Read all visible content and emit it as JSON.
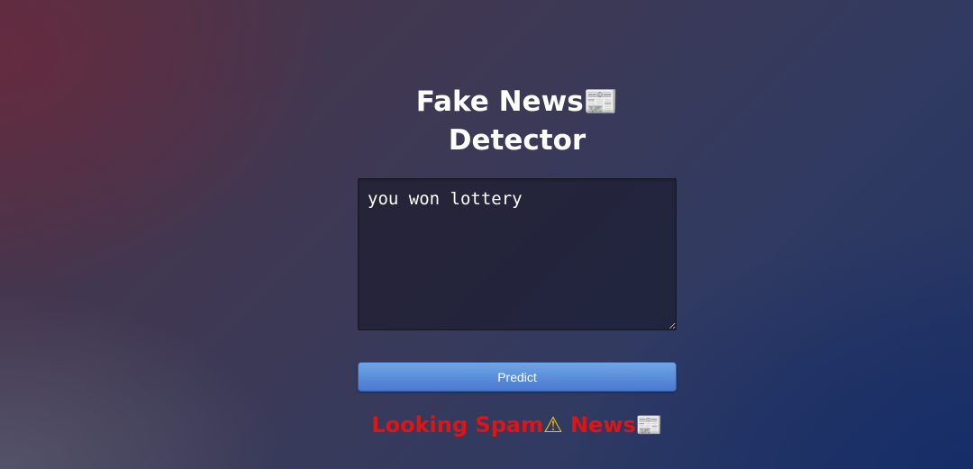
{
  "header": {
    "title_line1": "Fake News",
    "title_line2": "Detector",
    "title_icon": "newspaper-icon"
  },
  "form": {
    "input_value": "you won lottery",
    "input_placeholder": "",
    "predict_label": "Predict"
  },
  "result": {
    "text_part1": "Looking Spam",
    "text_part2": "News",
    "warning_icon": "warning-icon",
    "newspaper_icon": "newspaper-icon",
    "color": "#e01414"
  },
  "colors": {
    "button": "#5b8fe0",
    "title": "#ffffff"
  }
}
